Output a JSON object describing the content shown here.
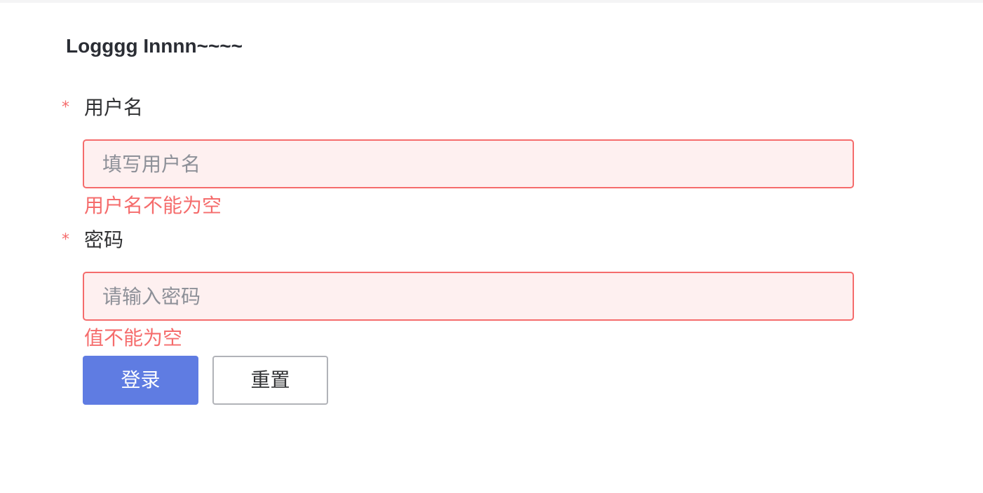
{
  "form": {
    "title": "Logggg Innnn~~~~",
    "username": {
      "required_mark": "*",
      "label": "用户名",
      "placeholder": "填写用户名",
      "value": "",
      "error": "用户名不能为空"
    },
    "password": {
      "required_mark": "*",
      "label": "密码",
      "placeholder": "请输入密码",
      "value": "",
      "error": "值不能为空"
    },
    "buttons": {
      "login_label": "登录",
      "reset_label": "重置"
    }
  },
  "colors": {
    "primary": "#5f7ce2",
    "error": "#f56c6c",
    "error_bg": "#fef0f0",
    "text": "#303133"
  }
}
